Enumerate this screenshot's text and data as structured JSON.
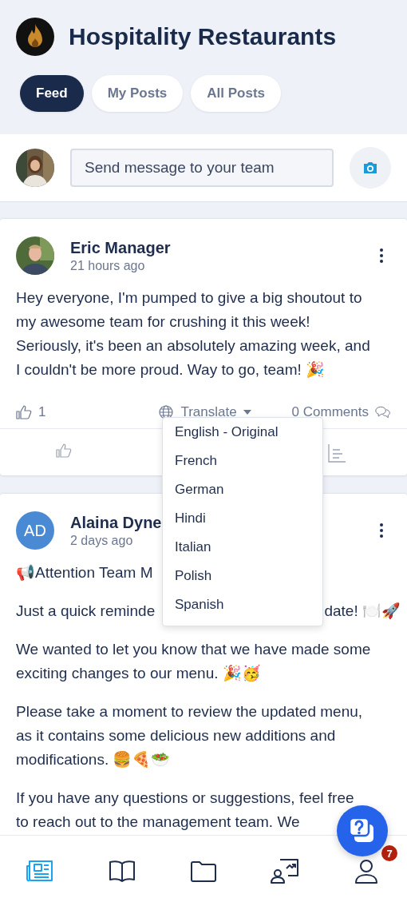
{
  "header": {
    "title": "Hospitality Restaurants"
  },
  "tabs": [
    {
      "label": "Feed",
      "selected": true
    },
    {
      "label": "My Posts",
      "selected": false
    },
    {
      "label": "All Posts",
      "selected": false
    }
  ],
  "composer": {
    "placeholder": "Send message to your team"
  },
  "posts": [
    {
      "author": "Eric Manager",
      "time": "21 hours ago",
      "avatar": {
        "kind": "picture"
      },
      "paragraphs": [
        {
          "kind": "text",
          "text": "Hey everyone, I'm pumped to give a big shoutout to my awesome team for crushing it this week! Seriously, it's been an absolutely amazing week, and I couldn't be more proud. Way to go, team! 🎉"
        }
      ],
      "likes": "1",
      "translate": "Translate",
      "comments": "0 Comments",
      "translate_menu": [
        "English - Original",
        "French",
        "German",
        "Hindi",
        "Italian",
        "Polish",
        "Spanish"
      ]
    },
    {
      "author": "Alaina Dyne",
      "time": "2 days ago",
      "avatar": {
        "kind": "initials",
        "text": "AD"
      },
      "paragraphs": [
        {
          "kind": "lines",
          "lines": [
            "📢Attention Team M"
          ]
        },
        {
          "kind": "split",
          "parts": [
            "Just a quick reminde",
            "date! 🍽️🚀"
          ]
        },
        {
          "kind": "text",
          "text": "We wanted to let you know that we have made some exciting changes to our menu. 🎉🥳"
        },
        {
          "kind": "text",
          "text": "Please take a moment to review the updated menu, as it contains some delicious new additions and modifications. 🍔🍕🥗"
        },
        {
          "kind": "lines",
          "lines": [
            "If you have any questions or suggestions, feel free",
            "to reach out to the management team. We"
          ]
        }
      ]
    }
  ],
  "nav": [
    {
      "selected": true
    },
    {
      "selected": false
    },
    {
      "selected": false
    },
    {
      "selected": false
    },
    {
      "selected": false,
      "badge": "7"
    }
  ]
}
